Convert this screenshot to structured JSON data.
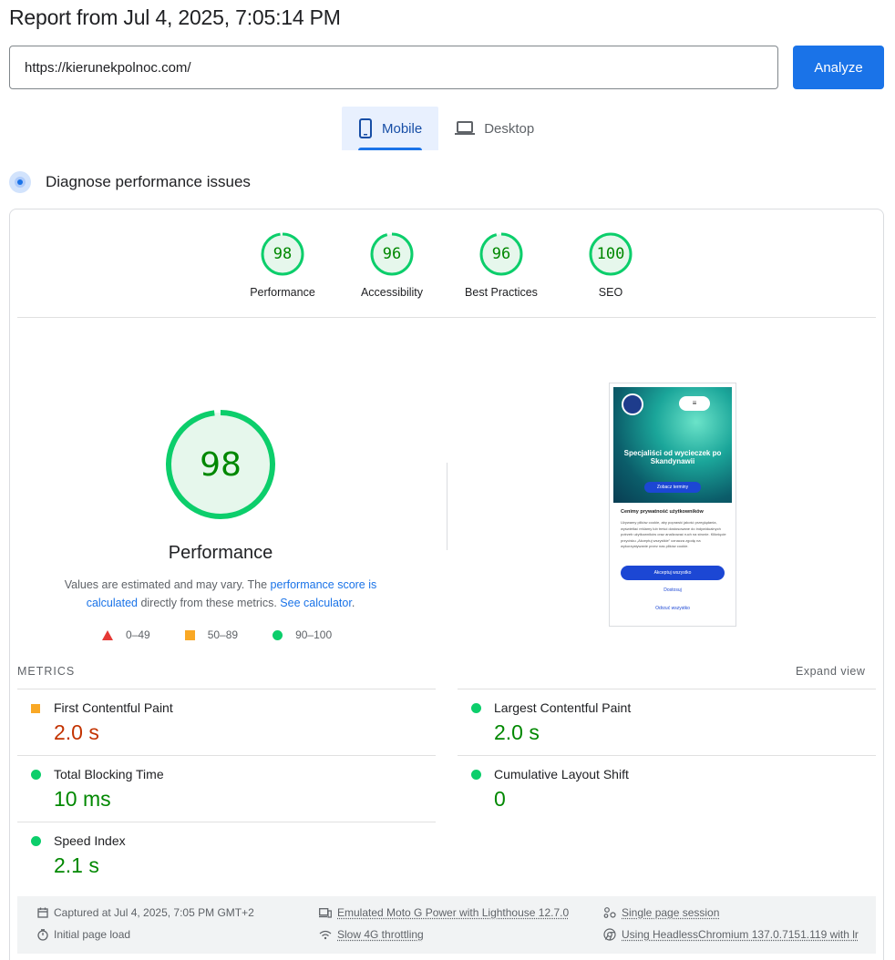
{
  "report": {
    "title": "Report from Jul 4, 2025, 7:05:14 PM"
  },
  "url_bar": {
    "value": "https://kierunekpolnoc.com/",
    "analyze_label": "Analyze"
  },
  "tabs": [
    {
      "label": "Mobile",
      "icon": "phone-icon",
      "active": true
    },
    {
      "label": "Desktop",
      "icon": "laptop-icon",
      "active": false
    }
  ],
  "diagnose": {
    "label": "Diagnose performance issues"
  },
  "categories": [
    {
      "label": "Performance",
      "score": "98"
    },
    {
      "label": "Accessibility",
      "score": "96"
    },
    {
      "label": "Best Practices",
      "score": "96"
    },
    {
      "label": "SEO",
      "score": "100"
    }
  ],
  "performance": {
    "score": "98",
    "label": "Performance",
    "desc_prefix": "Values are estimated and may vary. The ",
    "desc_link1": "performance score is calculated",
    "desc_middle": " directly from these metrics. ",
    "desc_link2": "See calculator",
    "desc_suffix": "."
  },
  "legend": [
    {
      "range": "0–49",
      "shape": "triangle",
      "color": "#e53935"
    },
    {
      "range": "50–89",
      "shape": "square",
      "color": "#f9a825"
    },
    {
      "range": "90–100",
      "shape": "circle",
      "color": "#0cce6b"
    }
  ],
  "screenshot": {
    "menu": "≡",
    "headline": "Specjaliści od wycieczek po Skandynawii",
    "cta": "Zobacz terminy",
    "cookie_title": "Cenimy prywatność użytkowników",
    "cookie_text": "Używamy plików cookie, aby poprawić jakość przeglądania, wyświetlać reklamy lub treści dostosowane do indywidualnych potrzeb użytkowników oraz analizować ruch na stronie. Kliknięcie przycisku „Akceptuj wszystkie” oznacza zgodę na wykorzystywanie przez nas plików cookie.",
    "accept": "Akceptuj wszystko",
    "customize": "Dostosuj",
    "reject": "Odrzuć wszystko"
  },
  "metrics": {
    "header": "METRICS",
    "expand_label": "Expand view",
    "items": [
      {
        "name": "First Contentful Paint",
        "value": "2.0 s",
        "status": "average"
      },
      {
        "name": "Largest Contentful Paint",
        "value": "2.0 s",
        "status": "pass"
      },
      {
        "name": "Total Blocking Time",
        "value": "10 ms",
        "status": "pass"
      },
      {
        "name": "Cumulative Layout Shift",
        "value": "0",
        "status": "pass"
      },
      {
        "name": "Speed Index",
        "value": "2.1 s",
        "status": "pass"
      }
    ]
  },
  "footer": {
    "captured": "Captured at Jul 4, 2025, 7:05 PM GMT+2",
    "load": "Initial page load",
    "device": "Emulated Moto G Power with Lighthouse 12.7.0",
    "throttling": "Slow 4G throttling",
    "session": "Single page session",
    "browser": "Using HeadlessChromium 137.0.7151.119 with lr"
  },
  "colors": {
    "accent": "#1a73e8",
    "pass": "#0cce6b",
    "average": "#f9a825",
    "fail": "#e53935"
  }
}
